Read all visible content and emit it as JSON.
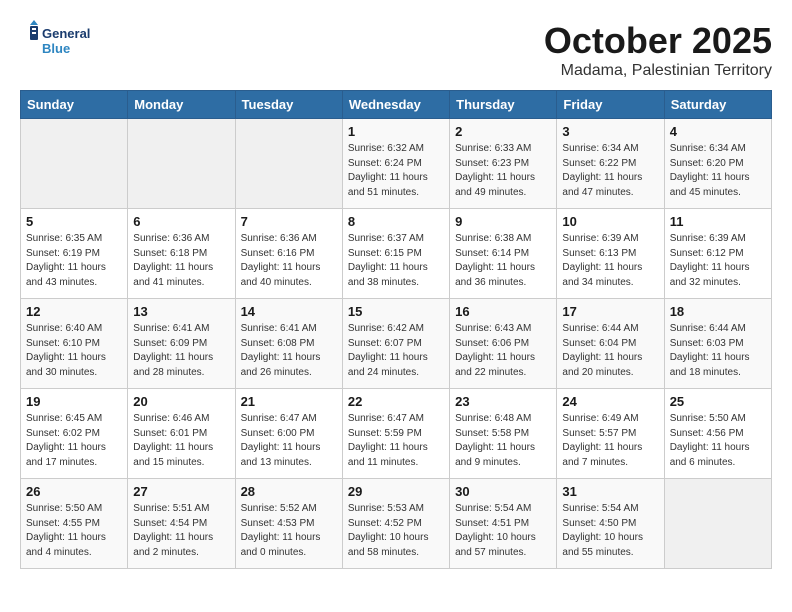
{
  "header": {
    "logo_line1": "General",
    "logo_line2": "Blue",
    "title": "October 2025",
    "subtitle": "Madama, Palestinian Territory"
  },
  "weekdays": [
    "Sunday",
    "Monday",
    "Tuesday",
    "Wednesday",
    "Thursday",
    "Friday",
    "Saturday"
  ],
  "weeks": [
    [
      {
        "day": "",
        "info": ""
      },
      {
        "day": "",
        "info": ""
      },
      {
        "day": "",
        "info": ""
      },
      {
        "day": "1",
        "info": "Sunrise: 6:32 AM\nSunset: 6:24 PM\nDaylight: 11 hours\nand 51 minutes."
      },
      {
        "day": "2",
        "info": "Sunrise: 6:33 AM\nSunset: 6:23 PM\nDaylight: 11 hours\nand 49 minutes."
      },
      {
        "day": "3",
        "info": "Sunrise: 6:34 AM\nSunset: 6:22 PM\nDaylight: 11 hours\nand 47 minutes."
      },
      {
        "day": "4",
        "info": "Sunrise: 6:34 AM\nSunset: 6:20 PM\nDaylight: 11 hours\nand 45 minutes."
      }
    ],
    [
      {
        "day": "5",
        "info": "Sunrise: 6:35 AM\nSunset: 6:19 PM\nDaylight: 11 hours\nand 43 minutes."
      },
      {
        "day": "6",
        "info": "Sunrise: 6:36 AM\nSunset: 6:18 PM\nDaylight: 11 hours\nand 41 minutes."
      },
      {
        "day": "7",
        "info": "Sunrise: 6:36 AM\nSunset: 6:16 PM\nDaylight: 11 hours\nand 40 minutes."
      },
      {
        "day": "8",
        "info": "Sunrise: 6:37 AM\nSunset: 6:15 PM\nDaylight: 11 hours\nand 38 minutes."
      },
      {
        "day": "9",
        "info": "Sunrise: 6:38 AM\nSunset: 6:14 PM\nDaylight: 11 hours\nand 36 minutes."
      },
      {
        "day": "10",
        "info": "Sunrise: 6:39 AM\nSunset: 6:13 PM\nDaylight: 11 hours\nand 34 minutes."
      },
      {
        "day": "11",
        "info": "Sunrise: 6:39 AM\nSunset: 6:12 PM\nDaylight: 11 hours\nand 32 minutes."
      }
    ],
    [
      {
        "day": "12",
        "info": "Sunrise: 6:40 AM\nSunset: 6:10 PM\nDaylight: 11 hours\nand 30 minutes."
      },
      {
        "day": "13",
        "info": "Sunrise: 6:41 AM\nSunset: 6:09 PM\nDaylight: 11 hours\nand 28 minutes."
      },
      {
        "day": "14",
        "info": "Sunrise: 6:41 AM\nSunset: 6:08 PM\nDaylight: 11 hours\nand 26 minutes."
      },
      {
        "day": "15",
        "info": "Sunrise: 6:42 AM\nSunset: 6:07 PM\nDaylight: 11 hours\nand 24 minutes."
      },
      {
        "day": "16",
        "info": "Sunrise: 6:43 AM\nSunset: 6:06 PM\nDaylight: 11 hours\nand 22 minutes."
      },
      {
        "day": "17",
        "info": "Sunrise: 6:44 AM\nSunset: 6:04 PM\nDaylight: 11 hours\nand 20 minutes."
      },
      {
        "day": "18",
        "info": "Sunrise: 6:44 AM\nSunset: 6:03 PM\nDaylight: 11 hours\nand 18 minutes."
      }
    ],
    [
      {
        "day": "19",
        "info": "Sunrise: 6:45 AM\nSunset: 6:02 PM\nDaylight: 11 hours\nand 17 minutes."
      },
      {
        "day": "20",
        "info": "Sunrise: 6:46 AM\nSunset: 6:01 PM\nDaylight: 11 hours\nand 15 minutes."
      },
      {
        "day": "21",
        "info": "Sunrise: 6:47 AM\nSunset: 6:00 PM\nDaylight: 11 hours\nand 13 minutes."
      },
      {
        "day": "22",
        "info": "Sunrise: 6:47 AM\nSunset: 5:59 PM\nDaylight: 11 hours\nand 11 minutes."
      },
      {
        "day": "23",
        "info": "Sunrise: 6:48 AM\nSunset: 5:58 PM\nDaylight: 11 hours\nand 9 minutes."
      },
      {
        "day": "24",
        "info": "Sunrise: 6:49 AM\nSunset: 5:57 PM\nDaylight: 11 hours\nand 7 minutes."
      },
      {
        "day": "25",
        "info": "Sunrise: 5:50 AM\nSunset: 4:56 PM\nDaylight: 11 hours\nand 6 minutes."
      }
    ],
    [
      {
        "day": "26",
        "info": "Sunrise: 5:50 AM\nSunset: 4:55 PM\nDaylight: 11 hours\nand 4 minutes."
      },
      {
        "day": "27",
        "info": "Sunrise: 5:51 AM\nSunset: 4:54 PM\nDaylight: 11 hours\nand 2 minutes."
      },
      {
        "day": "28",
        "info": "Sunrise: 5:52 AM\nSunset: 4:53 PM\nDaylight: 11 hours\nand 0 minutes."
      },
      {
        "day": "29",
        "info": "Sunrise: 5:53 AM\nSunset: 4:52 PM\nDaylight: 10 hours\nand 58 minutes."
      },
      {
        "day": "30",
        "info": "Sunrise: 5:54 AM\nSunset: 4:51 PM\nDaylight: 10 hours\nand 57 minutes."
      },
      {
        "day": "31",
        "info": "Sunrise: 5:54 AM\nSunset: 4:50 PM\nDaylight: 10 hours\nand 55 minutes."
      },
      {
        "day": "",
        "info": ""
      }
    ]
  ]
}
